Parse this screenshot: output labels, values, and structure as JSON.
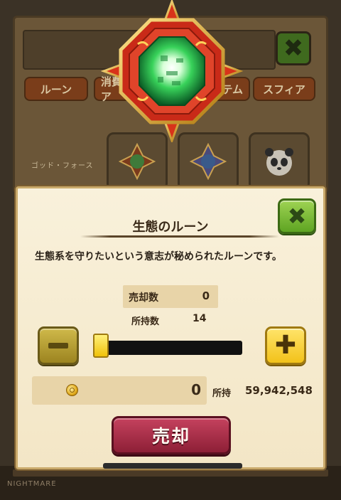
{
  "background": {
    "tabs": [
      "ルーン",
      "消費ア",
      "テム",
      "スフィア"
    ],
    "section_label": "ゴッド・フォース",
    "watermark": "NIGHTMARE"
  },
  "dialog": {
    "title": "生態のルーン",
    "description": "生態系を守りたいという意志が秘められたルーンです。",
    "sell_count_label": "売却数",
    "sell_count_value": "0",
    "owned_label": "所持数",
    "owned_value": "14",
    "slider_fraction": 0,
    "gold_value": "0",
    "owned_gold_label": "所持",
    "owned_gold_value": "59,942,548",
    "sell_button_label": "売却",
    "close_icon": "close-x-icon",
    "minus_icon": "minus-icon",
    "plus_icon": "plus-icon",
    "coin_icon": "gold-coin-icon"
  },
  "colors": {
    "close_button": "#6ab22a",
    "plus_button": "#f5c822",
    "minus_button": "#b89e30",
    "sell_button": "#a32d47",
    "panel": "#f6ebd0"
  }
}
